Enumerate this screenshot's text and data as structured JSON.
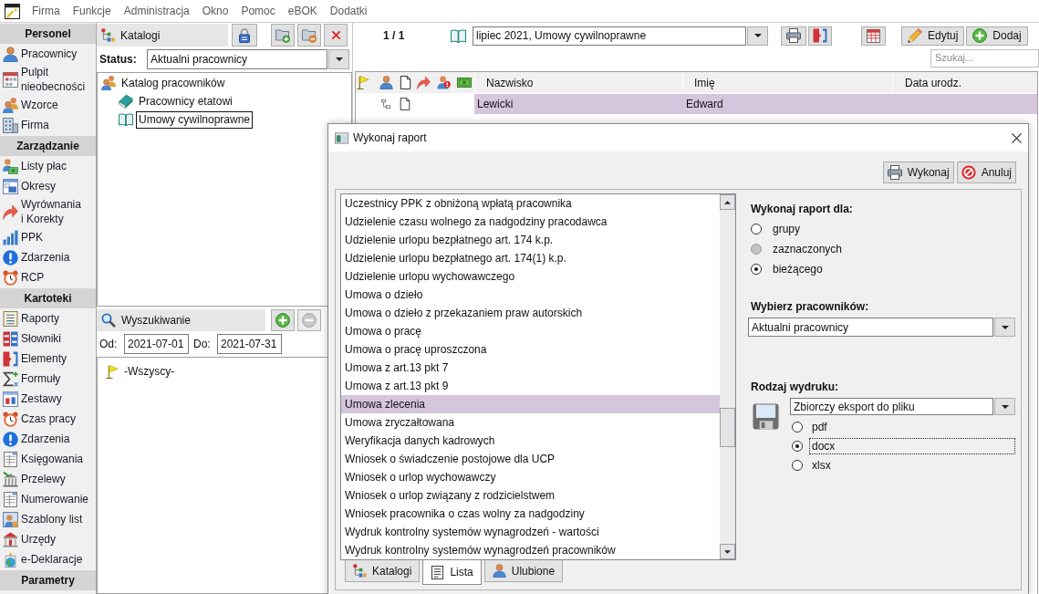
{
  "menu_bar": {
    "items": [
      "Firma",
      "Funkcje",
      "Administracja",
      "Okno",
      "Pomoc",
      "eBOK",
      "Dodatki"
    ]
  },
  "sidebar": {
    "sections": [
      {
        "title": "Personel",
        "items": [
          "Pracownicy",
          "Pulpit nieobecności",
          "Wzorce",
          "Firma"
        ]
      },
      {
        "title": "Zarządzanie",
        "items": [
          "Listy płac",
          "Okresy",
          "Wyrównania i Korekty",
          "PPK",
          "Zdarzenia",
          "RCP"
        ]
      },
      {
        "title": "Kartoteki",
        "items": [
          "Raporty",
          "Słowniki",
          "Elementy",
          "Formuły",
          "Zestawy",
          "Czas pracy",
          "Zdarzenia",
          "Księgowania",
          "Przelewy",
          "Numerowanie",
          "Szablony list",
          "Urzędy",
          "e-Deklaracje"
        ]
      },
      {
        "title": "Parametry"
      }
    ]
  },
  "catalogs": {
    "title": "Katalogi",
    "status_label": "Status:",
    "status_value": "Aktualni pracownicy",
    "tree": [
      {
        "label": "Katalog pracowników",
        "selected": false,
        "children": [
          {
            "label": "Pracownicy etatowi",
            "selected": false
          },
          {
            "label": "Umowy cywilnoprawne",
            "selected": true
          }
        ]
      }
    ]
  },
  "search_panel": {
    "title": "Wyszukiwanie",
    "from_label": "Od:",
    "from_value": "2021-07-01",
    "to_label": "Do:",
    "to_value": "2021-07-31",
    "tree": [
      {
        "label": "-Wszyscy-"
      }
    ]
  },
  "toolbar": {
    "record_counter": "1 / 1",
    "period": "lipiec 2021, Umowy cywilnoprawne",
    "buttons": [
      "Edytuj",
      "Dodaj"
    ],
    "search": {
      "placeholder": "Szukaj..."
    }
  },
  "table": {
    "columns": [
      "Nazwisko",
      "Imię",
      "Data urodz."
    ],
    "rows": [
      {
        "cells": [
          "Lewicki",
          "Edward"
        ],
        "selected": true
      }
    ]
  },
  "dialog": {
    "title": "Wykonaj raport",
    "buttons": [
      "Wykonaj",
      "Anuluj"
    ],
    "report_list": {
      "items": [
        {
          "label": "Uczestnicy PPK z obniżoną wpłatą pracownika",
          "selected": false
        },
        {
          "label": "Udzielenie czasu wolnego za nadgodziny pracodawca",
          "selected": false
        },
        {
          "label": "Udzielenie urlopu bezpłatnego art. 174 k.p.",
          "selected": false
        },
        {
          "label": "Udzielenie urlopu bezpłatnego art. 174(1) k.p.",
          "selected": false
        },
        {
          "label": "Udzielenie urlopu wychowawczego",
          "selected": false
        },
        {
          "label": "Umowa o dzieło",
          "selected": false
        },
        {
          "label": "Umowa o dzieło z przekazaniem praw autorskich",
          "selected": false
        },
        {
          "label": "Umowa o pracę",
          "selected": false
        },
        {
          "label": "Umowa o pracę uproszczona",
          "selected": false
        },
        {
          "label": "Umowa z art.13 pkt 7",
          "selected": false
        },
        {
          "label": "Umowa z art.13 pkt 9",
          "selected": false
        },
        {
          "label": "Umowa zlecenia",
          "selected": true
        },
        {
          "label": "Umowa zryczałtowana",
          "selected": false
        },
        {
          "label": "Weryfikacja danych kadrowych",
          "selected": false
        },
        {
          "label": "Wniosek o świadczenie postojowe dla UCP",
          "selected": false
        },
        {
          "label": "Wniosek o urlop wychowawczy",
          "selected": false
        },
        {
          "label": "Wniosek o urlop związany z rodzicielstwem",
          "selected": false
        },
        {
          "label": "Wniosek pracownika o czas wolny za nadgodziny",
          "selected": false
        },
        {
          "label": "Wydruk kontrolny systemów wynagrodzeń - wartości",
          "selected": false
        },
        {
          "label": "Wydruk kontrolny systemów wynagrodzeń pracowników",
          "selected": false
        }
      ]
    },
    "tabs": [
      {
        "label": "Katalogi",
        "selected": false
      },
      {
        "label": "Lista",
        "selected": true
      },
      {
        "label": "Ulubione",
        "selected": false
      }
    ],
    "scope": {
      "title": "Wykonaj raport dla:",
      "options": [
        {
          "label": "grupy",
          "selected": false,
          "disabled": false
        },
        {
          "label": "zaznaczonych",
          "selected": false,
          "disabled": true
        },
        {
          "label": "bieżącego",
          "selected": true,
          "disabled": false
        }
      ]
    },
    "employees": {
      "title": "Wybierz pracowników:",
      "value": "Aktualni pracownicy"
    },
    "output": {
      "title": "Rodzaj wydruku:",
      "value": "Zbiorczy eksport do pliku",
      "formats": [
        {
          "label": "pdf",
          "selected": false
        },
        {
          "label": "docx",
          "selected": true
        },
        {
          "label": "xlsx",
          "selected": false
        }
      ]
    }
  }
}
